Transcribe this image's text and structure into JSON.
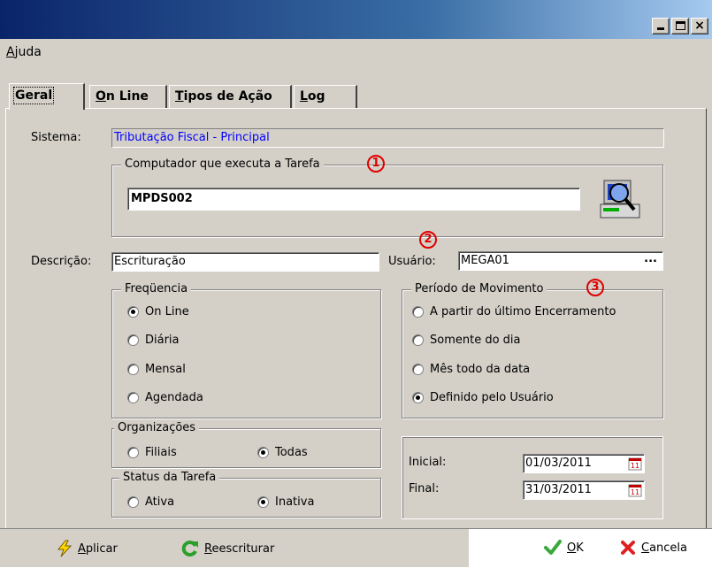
{
  "window": {
    "title": ""
  },
  "menu": {
    "help": {
      "mnemonic": "A",
      "rest": "juda"
    }
  },
  "tabs": [
    {
      "mnemonic": "",
      "label": "Geral",
      "active": true
    },
    {
      "mnemonic": "O",
      "label": "n Line",
      "active": false
    },
    {
      "mnemonic": "T",
      "label": "ipos de Ação",
      "active": false
    },
    {
      "mnemonic": "L",
      "label": "og",
      "active": false
    }
  ],
  "sistema": {
    "label": "Sistema:",
    "value": "Tributação Fiscal - Principal",
    "value_color": "#0000ff"
  },
  "computador": {
    "legend": "Computador que executa a Tarefa",
    "value": "MPDS002",
    "icon": "computer-search-icon"
  },
  "descricao": {
    "label": "Descrição:",
    "value": "Escrituração"
  },
  "usuario": {
    "label": "Usuário:",
    "value": "MEGA01",
    "ellipsis": "..."
  },
  "frequencia": {
    "legend": "Freqüencia",
    "options": [
      "On Line",
      "Diária",
      "Mensal",
      "Agendada"
    ],
    "selected": "On Line"
  },
  "periodo": {
    "legend": "Período de Movimento",
    "options": [
      "A partir do último Encerramento",
      "Somente do dia",
      "Mês todo da data",
      "Definido pelo Usuário"
    ],
    "selected": "Definido pelo Usuário"
  },
  "organizacoes": {
    "legend": "Organizações",
    "options": [
      "Filiais",
      "Todas"
    ],
    "selected": "Todas"
  },
  "status_tarefa": {
    "legend": "Status da Tarefa",
    "options": [
      "Ativa",
      "Inativa"
    ],
    "selected": "Inativa"
  },
  "datas": {
    "inicial_label": "Inicial:",
    "inicial_value": "01/03/2011",
    "final_label": "Final:",
    "final_value": "31/03/2011"
  },
  "annotations": [
    "1",
    "2",
    "3"
  ],
  "footer": {
    "aplicar": {
      "mnemonic": "A",
      "rest": "plicar"
    },
    "reescriturar": {
      "mnemonic": "R",
      "rest": "eescriturar"
    },
    "ok": {
      "mnemonic": "O",
      "rest": "K"
    },
    "cancela": {
      "mnemonic": "C",
      "rest": "ancela"
    }
  },
  "colors": {
    "face": "#d4d0c8",
    "annotation_red": "#e00000",
    "link_blue": "#0000ff"
  }
}
